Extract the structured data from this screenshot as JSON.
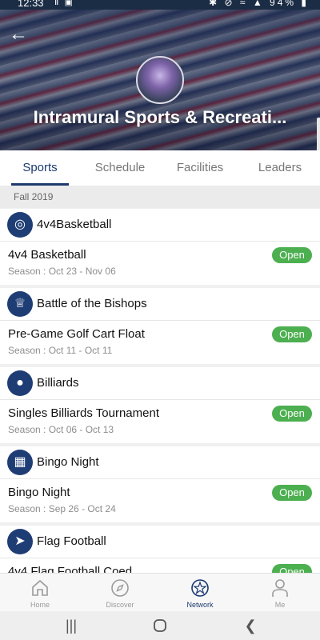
{
  "status_bar": {
    "time": "12:33",
    "indicators": "Ⅱ ▣",
    "right": "✱ ⊘ ≈ ▲ 94% ▮"
  },
  "header": {
    "org_title": "Intramural Sports & Recreati..."
  },
  "tabs": [
    {
      "label": "Sports",
      "active": true
    },
    {
      "label": "Schedule",
      "active": false
    },
    {
      "label": "Facilities",
      "active": false
    },
    {
      "label": "Leaders",
      "active": false
    }
  ],
  "season_header": "Fall 2019",
  "sports": [
    {
      "name": "4v4Basketball",
      "icon": "basketball-icon",
      "glyph": "◎",
      "event": {
        "name": "4v4 Basketball",
        "season": "Season : Oct 23 - Nov 06",
        "status": "Open"
      }
    },
    {
      "name": "Battle of the Bishops",
      "icon": "trophy-icon",
      "glyph": "♕",
      "event": {
        "name": "Pre-Game Golf Cart Float",
        "season": "Season : Oct 11 - Oct 11",
        "status": "Open"
      }
    },
    {
      "name": "Billiards",
      "icon": "billiards-icon",
      "glyph": "●",
      "event": {
        "name": "Singles Billiards Tournament",
        "season": "Season : Oct 06 - Oct 13",
        "status": "Open"
      }
    },
    {
      "name": "Bingo Night",
      "icon": "bingo-icon",
      "glyph": "▦",
      "event": {
        "name": "Bingo Night",
        "season": "Season : Sep 26 - Oct 24",
        "status": "Open"
      }
    },
    {
      "name": "Flag Football",
      "icon": "football-icon",
      "glyph": "➤",
      "event": {
        "name": "4v4 Flag Football Coed",
        "season": "",
        "status": "Open"
      }
    }
  ],
  "bottom_nav": [
    {
      "label": "Home",
      "icon": "home-icon",
      "active": false
    },
    {
      "label": "Discover",
      "icon": "compass-icon",
      "active": false
    },
    {
      "label": "Network",
      "icon": "network-icon",
      "active": true
    },
    {
      "label": "Me",
      "icon": "person-icon",
      "active": false
    }
  ],
  "colors": {
    "primary": "#1c3a6e",
    "open_badge": "#4caf50",
    "status_bar": "#1b2c45"
  }
}
